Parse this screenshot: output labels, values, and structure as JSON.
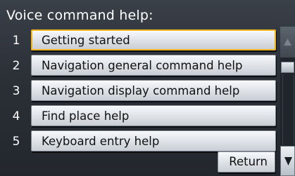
{
  "screen": {
    "title": "Voice command help:"
  },
  "menu": {
    "items": [
      {
        "number": "1",
        "label": "Getting started",
        "selected": true
      },
      {
        "number": "2",
        "label": "Navigation general command help",
        "selected": false
      },
      {
        "number": "3",
        "label": "Navigation display command help",
        "selected": false
      },
      {
        "number": "4",
        "label": "Find place help",
        "selected": false
      },
      {
        "number": "5",
        "label": "Keyboard entry help",
        "selected": false
      }
    ]
  },
  "footer": {
    "return_label": "Return"
  },
  "scrollbar": {
    "up_icon": "triangle-up-icon",
    "down_icon": "triangle-down-icon"
  },
  "colors": {
    "selection_border": "#f0b41e",
    "background": "#2b3037"
  }
}
